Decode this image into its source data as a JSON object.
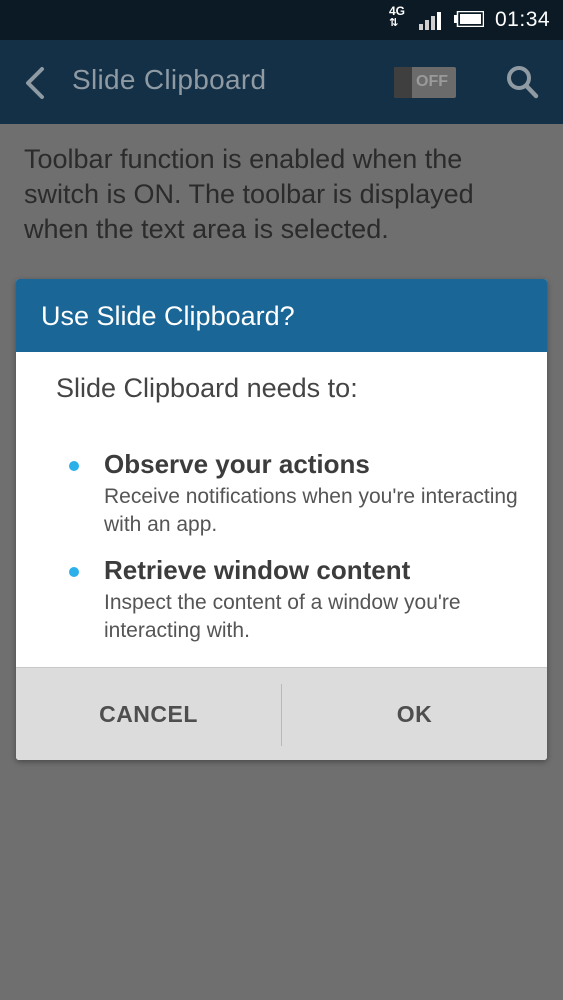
{
  "status_bar": {
    "network": "4G",
    "time": "01:34"
  },
  "app_bar": {
    "title": "Slide Clipboard",
    "toggle_label": "OFF",
    "icons": [
      "back-icon",
      "search-icon"
    ]
  },
  "description": "Toolbar function is enabled when the switch is ON. The toolbar is displayed when the text area is selected.",
  "dialog": {
    "title": "Use Slide Clipboard?",
    "intro": "Slide Clipboard needs to:",
    "permissions": [
      {
        "title": "Observe your actions",
        "description": "Receive notifications when you're interacting with an app."
      },
      {
        "title": "Retrieve window content",
        "description": "Inspect the content of a window you're interacting with."
      }
    ],
    "cancel_label": "CANCEL",
    "ok_label": "OK"
  },
  "colors": {
    "status_bar": "#0b1a24",
    "app_bar": "#133047",
    "dialog_header": "#1a6696",
    "bullet": "#2bb0ea",
    "scrim": "#6f6f6f"
  }
}
